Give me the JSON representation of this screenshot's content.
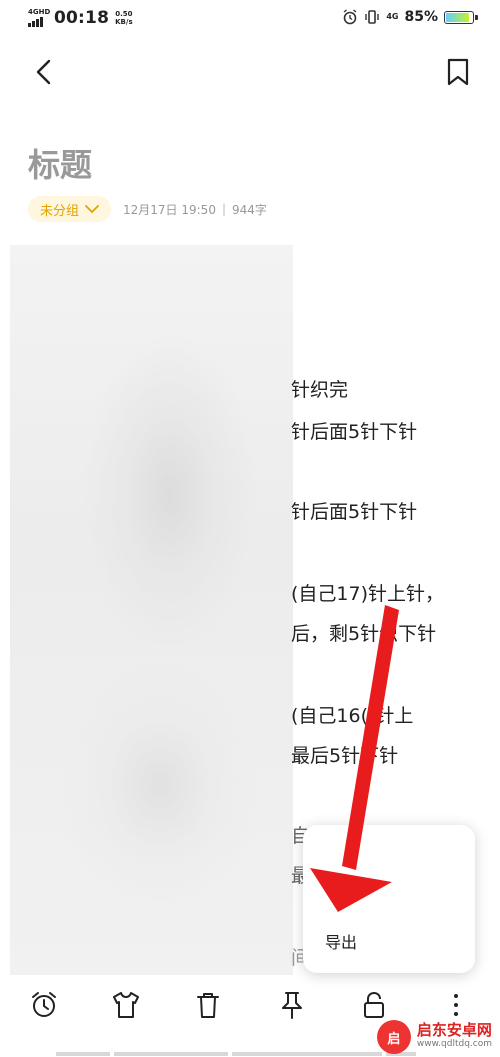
{
  "status_bar": {
    "network": "4GHD",
    "time": "00:18",
    "speed_value": "0.50",
    "speed_unit": "KB/s",
    "signal_4g": "4G",
    "battery_pct": "85%",
    "battery_level": 0.85
  },
  "note": {
    "title": "标题",
    "group": "未分组",
    "date": "12月17日 19:50",
    "separator": "|",
    "word_count": "944字",
    "visible_lines": [
      "针织完",
      "针后面5针下针",
      "针后面5针下针",
      "(自己17)针上针，",
      "后，剩5针织下针",
      "(自己16()针上",
      "最后5针下针",
      "自己",
      "最 分",
      "间"
    ]
  },
  "popup": {
    "export_label": "导出"
  },
  "toolbar": {
    "items": [
      "alarm-icon",
      "shirt-icon",
      "trash-icon",
      "pin-icon",
      "lock-icon",
      "more-icon"
    ]
  },
  "watermark": {
    "logo": "启",
    "name": "启东安卓网",
    "url": "www.qdltdq.com"
  },
  "colors": {
    "accent": "#e0a300",
    "chip_bg": "#fff6e0",
    "arrow": "#e81c1c"
  }
}
